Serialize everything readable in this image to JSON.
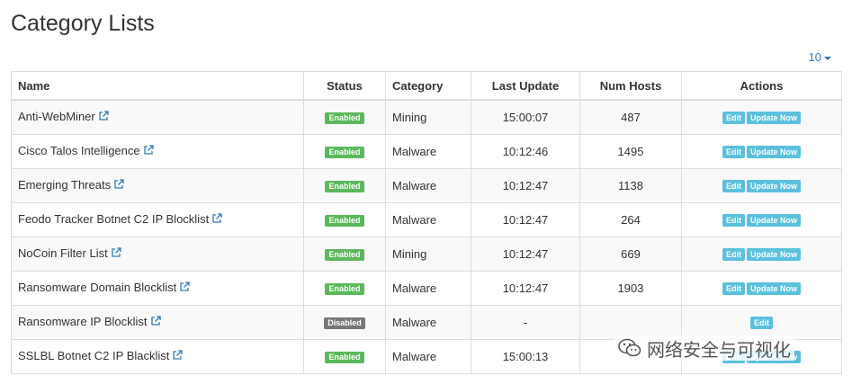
{
  "page": {
    "title": "Category Lists",
    "page_size": "10"
  },
  "table": {
    "headers": {
      "name": "Name",
      "status": "Status",
      "category": "Category",
      "last_update": "Last Update",
      "num_hosts": "Num Hosts",
      "actions": "Actions"
    },
    "rows": [
      {
        "name": "Anti-WebMiner",
        "status": "Enabled",
        "category": "Mining",
        "last_update": "15:00:07",
        "num_hosts": "487",
        "edit": "Edit",
        "update": "Update Now"
      },
      {
        "name": "Cisco Talos Intelligence",
        "status": "Enabled",
        "category": "Malware",
        "last_update": "10:12:46",
        "num_hosts": "1495",
        "edit": "Edit",
        "update": "Update Now"
      },
      {
        "name": "Emerging Threats",
        "status": "Enabled",
        "category": "Malware",
        "last_update": "10:12:47",
        "num_hosts": "1138",
        "edit": "Edit",
        "update": "Update Now"
      },
      {
        "name": "Feodo Tracker Botnet C2 IP Blocklist",
        "status": "Enabled",
        "category": "Malware",
        "last_update": "10:12:47",
        "num_hosts": "264",
        "edit": "Edit",
        "update": "Update Now"
      },
      {
        "name": "NoCoin Filter List",
        "status": "Enabled",
        "category": "Mining",
        "last_update": "10:12:47",
        "num_hosts": "669",
        "edit": "Edit",
        "update": "Update Now"
      },
      {
        "name": "Ransomware Domain Blocklist",
        "status": "Enabled",
        "category": "Malware",
        "last_update": "10:12:47",
        "num_hosts": "1903",
        "edit": "Edit",
        "update": "Update Now"
      },
      {
        "name": "Ransomware IP Blocklist",
        "status": "Disabled",
        "category": "Malware",
        "last_update": "-",
        "num_hosts": "",
        "edit": "Edit",
        "update": ""
      },
      {
        "name": "SSLBL Botnet C2 IP Blacklist",
        "status": "Enabled",
        "category": "Malware",
        "last_update": "15:00:13",
        "num_hosts": "",
        "edit": "Edit",
        "update": "Update Now"
      }
    ]
  },
  "watermark": {
    "text": "网络安全与可视化",
    "icon": "wechat-icon"
  },
  "colors": {
    "enabled": "#5cb85c",
    "disabled": "#777777",
    "action_button": "#5bc0de",
    "link": "#337ab7"
  }
}
